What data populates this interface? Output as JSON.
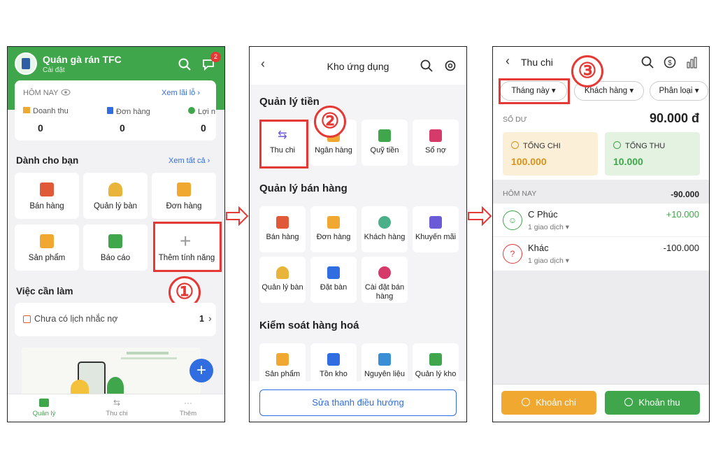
{
  "screen1": {
    "shop_name": "Quán gà rán TFC",
    "settings_link": "Cài đặt",
    "notif_count": "2",
    "today_label": "HÔM NAY",
    "profit_link": "Xem lãi lỗ",
    "stats": [
      {
        "label": "Doanh thu",
        "value": "0"
      },
      {
        "label": "Đơn hàng",
        "value": "0"
      },
      {
        "label": "Lợi n",
        "value": "0"
      }
    ],
    "for_you_title": "Dành cho bạn",
    "see_all": "Xem tất cả",
    "tiles": [
      "Bán hàng",
      "Quản lý bàn",
      "Đơn hàng",
      "Sản phẩm",
      "Báo cáo",
      "Thêm tính năng"
    ],
    "todo_title": "Việc cần làm",
    "todo_item": "Chưa có lịch nhắc nợ",
    "todo_count": "1",
    "nav": [
      "Quản lý",
      "Thu chi",
      "Thêm"
    ]
  },
  "screen2": {
    "title": "Kho ứng dụng",
    "sections": [
      {
        "title": "Quản lý tiền",
        "items": [
          "Thu chi",
          "Ngân hàng",
          "Quỹ tiền",
          "Sổ nợ"
        ]
      },
      {
        "title": "Quản lý bán hàng",
        "items": [
          "Bán hàng",
          "Đơn hàng",
          "Khách hàng",
          "Khuyến mãi",
          "Quản lý bàn",
          "Đặt bàn",
          "Cài đặt bán hàng"
        ]
      },
      {
        "title": "Kiểm soát hàng hoá",
        "items": [
          "Sản phẩm",
          "Tồn kho",
          "Nguyên liệu",
          "Quản lý kho"
        ]
      }
    ],
    "edit_nav_button": "Sửa thanh điều hướng"
  },
  "screen3": {
    "title": "Thu chi",
    "filters": [
      "Tháng này",
      "Khách hàng",
      "Phân loại"
    ],
    "balance_label": "SỐ DƯ",
    "balance_value": "90.000 đ",
    "total_out_label": "TỔNG CHI",
    "total_out_value": "100.000",
    "total_in_label": "TỔNG THU",
    "total_in_value": "10.000",
    "today_label": "HÔM NAY",
    "today_total": "-90.000",
    "transactions": [
      {
        "name": "C Phúc",
        "sub": "1 giao dịch",
        "amount": "+10.000"
      },
      {
        "name": "Khác",
        "sub": "1 giao dịch",
        "amount": "-100.000"
      }
    ],
    "btn_out": "Khoản chi",
    "btn_in": "Khoản thu"
  },
  "steps": [
    "①",
    "②",
    "③"
  ],
  "colors": {
    "green": "#3fa64b",
    "red": "#e53935",
    "orange": "#f0a830",
    "blue": "#2f6de1"
  }
}
